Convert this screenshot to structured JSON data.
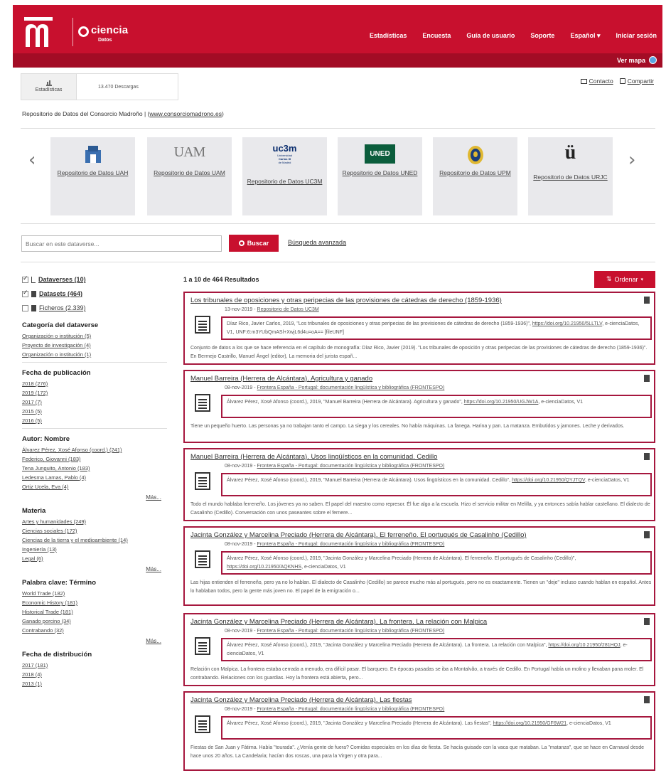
{
  "header": {
    "brand_name": "ciencia",
    "brand_sub": "Datos",
    "nav": [
      "Estadísticas",
      "Encuesta",
      "Guía de usuario",
      "Soporte",
      "Español ▾",
      "Iniciar sesión"
    ],
    "map_link": "Ver mapa"
  },
  "metrics": {
    "label": "Estadísticas",
    "downloads": "13.470 Descargas"
  },
  "actions": {
    "contact": "Contacto",
    "share": "Compartir"
  },
  "repo": {
    "desc_prefix": "Repositorio de Datos del Consorcio Madroño | (",
    "desc_link": "www.consorciomadrono.es",
    "desc_suffix": ")"
  },
  "carousel": {
    "prev": "‹",
    "next": "›",
    "cards": [
      {
        "label": "Repositorio de Datos UAH",
        "logo": "UAH"
      },
      {
        "label": "Repositorio de Datos UAM",
        "logo": "UAM"
      },
      {
        "label": "Repositorio de Datos UC3M",
        "logo": "uc3m"
      },
      {
        "label": "Repositorio de Datos UNED",
        "logo": "UNED"
      },
      {
        "label": "Repositorio de Datos UPM",
        "logo": "UPM"
      },
      {
        "label": "Repositorio de Datos URJC",
        "logo": "ü"
      }
    ],
    "uc3m_lines": [
      "Universidad",
      "Carlos III",
      "de Madrid"
    ]
  },
  "search": {
    "placeholder": "Buscar en este dataverse...",
    "button": "Buscar",
    "advanced": "Búsqueda avanzada"
  },
  "sidebar": {
    "types": [
      {
        "label": "Dataverses",
        "count": "(10)",
        "checked": true
      },
      {
        "label": "Datasets",
        "count": "(464)",
        "checked": true
      },
      {
        "label": "Ficheros",
        "count": "(2.339)",
        "checked": false
      }
    ],
    "facets": [
      {
        "title": "Categoría del dataverse",
        "items": [
          "Organización o institución (5)",
          "Proyecto de investigación (4)",
          "Organización o institución (1)"
        ],
        "more": ""
      },
      {
        "title": "Fecha de publicación",
        "items": [
          "2018 (276)",
          "2019 (172)",
          "2017 (7)",
          "2015 (5)",
          "2016 (5)"
        ],
        "more": ""
      },
      {
        "title": "Autor: Nombre",
        "items": [
          "Álvarez Pérez, Xosé Afonso (coord.) (241)",
          "Federico, Giovanni (183)",
          "Tena Junguito, Antonio (183)",
          "Ledesma Lamas, Pablo (4)",
          "Ortiz Ucela, Eva (4)"
        ],
        "more": "Más..."
      },
      {
        "title": "Materia",
        "items": [
          "Artes y humanidades (249)",
          "Ciencias sociales (172)",
          "Ciencias de la tierra y el medioambiente (14)",
          "Ingeniería (13)",
          "Legal (6)"
        ],
        "more": "Más..."
      },
      {
        "title": "Palabra clave: Término",
        "items": [
          "World Trade (182)",
          "Economic History (181)",
          "Historical Trade (181)",
          "Ganado porcino (34)",
          "Contrabando (32)"
        ],
        "more": "Más..."
      },
      {
        "title": "Fecha de distribución",
        "items": [
          "2017 (181)",
          "2018 (4)",
          "2013 (1)"
        ],
        "more": ""
      }
    ]
  },
  "results": {
    "count": "1 a 10 de 464 Resultados",
    "order_button": "Ordenar",
    "items": [
      {
        "title": "Los tribunales de oposiciones y otras peripecias de las provisiones de cátedras de derecho (1859-1936)",
        "date": "13-nov-2019 - ",
        "source": "Repositorio de Datos UC3M",
        "cite_text": "Díaz Rico, Javier Carlos, 2019, \"Los tribunales de oposiciones y otras peripecias de las provisiones de cátedras de derecho (1859-1936)\", ",
        "cite_link": "https://doi.org/10.21950/5LLTLV",
        "cite_suffix": ", e-cienciaDatos, V1, UNF:6:m3YUbQmASl+XwjL6d4u=oA== [fileUNF]",
        "desc": "Conjunto de datos a los que se hace referencia en el capítulo de monografía: Díaz Rico, Javier (2019). \"Los tribunales de oposición y otras peripecias de las provisiones de cátedras de derecho (1859-1936)\". En Bermejo Castrillo, Manuel Ángel (editor), La memoria del jurista españ..."
      },
      {
        "title": "Manuel Barreira (Herrera de Alcántara). Agricultura y ganado",
        "date": "08-nov-2019 - ",
        "source": "Frontera España - Portugal: documentación lingüística y bibliográfica (FRONTESPO)",
        "cite_text": "Álvarez Pérez, Xosé Afonso (coord.), 2019, \"Manuel Barreira (Herrera de Alcántara). Agricultura y ganado\", ",
        "cite_link": "https://doi.org/10.21950/UGJW1A",
        "cite_suffix": ", e-cienciaDatos, V1",
        "desc": "Tiene un pequeño huerto. Las personas ya no trabajan tanto el campo. La siega y los cereales. No había máquinas. La fanega. Harina y pan. La matanza. Embutidos y jamones. Leche y derivados."
      },
      {
        "title": "Manuel Barreira (Herrera de Alcántara). Usos lingüísticos en la comunidad. Cedillo",
        "date": "08-nov-2019 - ",
        "source": "Frontera España - Portugal: documentación lingüística y bibliográfica (FRONTESPO)",
        "cite_text": "Álvarez Pérez, Xosé Afonso (coord.), 2019, \"Manuel Barreira (Herrera de Alcántara). Usos lingüísticos en la comunidad. Cedillo\", ",
        "cite_link": "https://doi.org/10.21950/QYJTQV",
        "cite_suffix": ", e-cienciaDatos, V1",
        "desc": "Todo el mundo hablaba ferreneño. Los jóvenes ya no saben. El papel del maestro como represor. Él fue algo a la escuela. Hizo el servicio militar en Melilla, y ya entonces sabía hablar castellano. El dialecto de Casalinho (Cedillo). Conversación con unos paseantes sobre el fernere..."
      },
      {
        "title": "Jacinta González y Marcelina Preciado (Herrera de Alcántara). El ferreneño. El portugués de Casalinho (Cedillo)",
        "date": "08-nov-2019 - ",
        "source": "Frontera España - Portugal: documentación lingüística y bibliográfica (FRONTESPO)",
        "cite_text": "Álvarez Pérez, Xosé Afonso (coord.), 2019, \"Jacinta González y Marcelina Preciado (Herrera de Alcántara). El ferreneño. El portugués de Casalinho (Cedillo)\", ",
        "cite_link": "https://doi.org/10.21950/AQKNHS",
        "cite_suffix": ", e-cienciaDatos, V1",
        "desc": "Las hijas entienden el ferreneño, pero ya no lo hablan. El dialecto de Casalinho (Cedillo) se parece mucho más al portugués, pero no es exactamente. Tienen un \"deje\" incluso cuando hablan en español. Antes lo hablaban todos, pero la gente más joven no. El papel de la emigración o..."
      },
      {
        "title": "Jacinta González y Marcelina Preciado (Herrera de Alcántara). La frontera. La relación con Malpica",
        "date": "08-nov-2019 - ",
        "source": "Frontera España - Portugal: documentación lingüística y bibliográfica (FRONTESPO)",
        "cite_text": "Álvarez Pérez, Xosé Afonso (coord.), 2019, \"Jacinta González y Marcelina Preciado (Herrera de Alcántara). La frontera. La relación con Malpica\", ",
        "cite_link": "https://doi.org/10.21950/281HQJ",
        "cite_suffix": ", e-cienciaDatos, V1",
        "desc": "Relación con Malpica. La frontera estaba cerrada a menudo, era difícil pasar. El barquero. En épocas pasadas se iba a Montalvão, a través de Cedillo. En Portugal había un molino y llevaban pana moler. El contrabando. Relaciones con los guardias. Hoy la frontera está abierta, pero..."
      },
      {
        "title": "Jacinta González y Marcelina Preciado (Herrera de Alcántara). Las fiestas",
        "date": "08-nov-2019 - ",
        "source": "Frontera España - Portugal: documentación lingüística y bibliográfica (FRONTESPO)",
        "cite_text": "Álvarez Pérez, Xosé Afonso (coord.), 2019, \"Jacinta González y Marcelina Preciado (Herrera de Alcántara). Las fiestas\", ",
        "cite_link": "https://doi.org/10.21950/GF6W21",
        "cite_suffix": ", e-cienciaDatos, V1",
        "desc": "Fiestas de San Juan y Fátima. Había \"tourada\". ¿Venía gente de fuera? Comidas especiales en los días de fiesta. Se hacía guisado con la vaca que mataban. La \"matanza\", que se hace en Carnaval desde hace unos 20 años. La Candelaria; hacían dos roscas, una para la Virgen y otra para..."
      }
    ]
  },
  "colors": {
    "brand": "#c8102e",
    "brand_dark": "#a30c25",
    "result_border": "#a6173e"
  }
}
